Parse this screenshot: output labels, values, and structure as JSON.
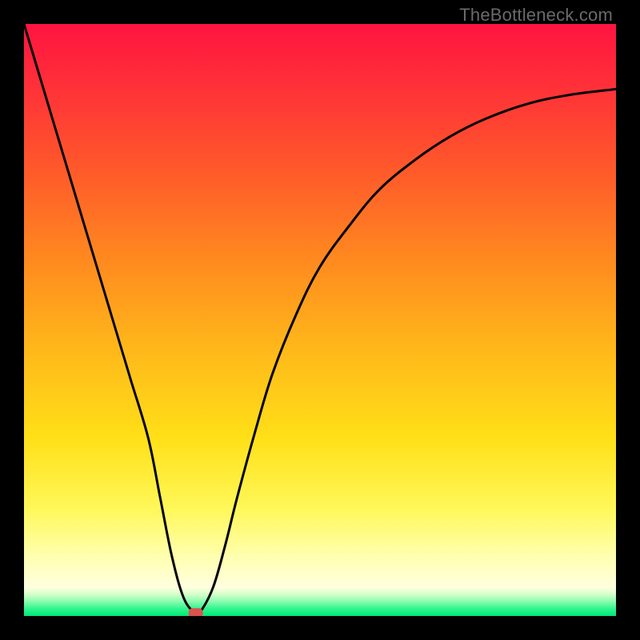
{
  "watermark": "TheBottleneck.com",
  "chart_data": {
    "type": "line",
    "title": "",
    "xlabel": "",
    "ylabel": "",
    "xlim": [
      0,
      100
    ],
    "ylim": [
      0,
      100
    ],
    "grid": false,
    "legend": null,
    "notes": "Color gradient background runs red (top) → orange → yellow → pale-yellow → thin green strip at bottom. Single black curve resembling a bottleneck V with right side rising asymptotically. One red marker at the minimum.",
    "x": [
      0,
      3,
      6,
      9,
      12,
      15,
      18,
      21,
      23,
      25,
      27,
      29,
      30,
      32,
      34,
      36,
      39,
      42,
      46,
      50,
      55,
      60,
      66,
      72,
      78,
      85,
      92,
      100
    ],
    "values": [
      100,
      90,
      80,
      70,
      60,
      50,
      40,
      30,
      20,
      10,
      3,
      0.5,
      1,
      5,
      12,
      20,
      31,
      41,
      51,
      59,
      66,
      72,
      77,
      81,
      84,
      86.5,
      88,
      89
    ],
    "marker": {
      "x": 29,
      "y": 0.5
    },
    "gradient_stops": [
      {
        "pos": 0,
        "color": "#ff1440"
      },
      {
        "pos": 0.1,
        "color": "#ff2f39"
      },
      {
        "pos": 0.25,
        "color": "#ff5a2a"
      },
      {
        "pos": 0.4,
        "color": "#ff8a1f"
      },
      {
        "pos": 0.55,
        "color": "#ffb81a"
      },
      {
        "pos": 0.7,
        "color": "#ffe018"
      },
      {
        "pos": 0.82,
        "color": "#fff85a"
      },
      {
        "pos": 0.9,
        "color": "#ffffb0"
      },
      {
        "pos": 0.952,
        "color": "#ffffe0"
      },
      {
        "pos": 0.963,
        "color": "#d8ffca"
      },
      {
        "pos": 0.975,
        "color": "#8dfcb0"
      },
      {
        "pos": 0.988,
        "color": "#2ef58e"
      },
      {
        "pos": 1.0,
        "color": "#00e874"
      }
    ]
  }
}
